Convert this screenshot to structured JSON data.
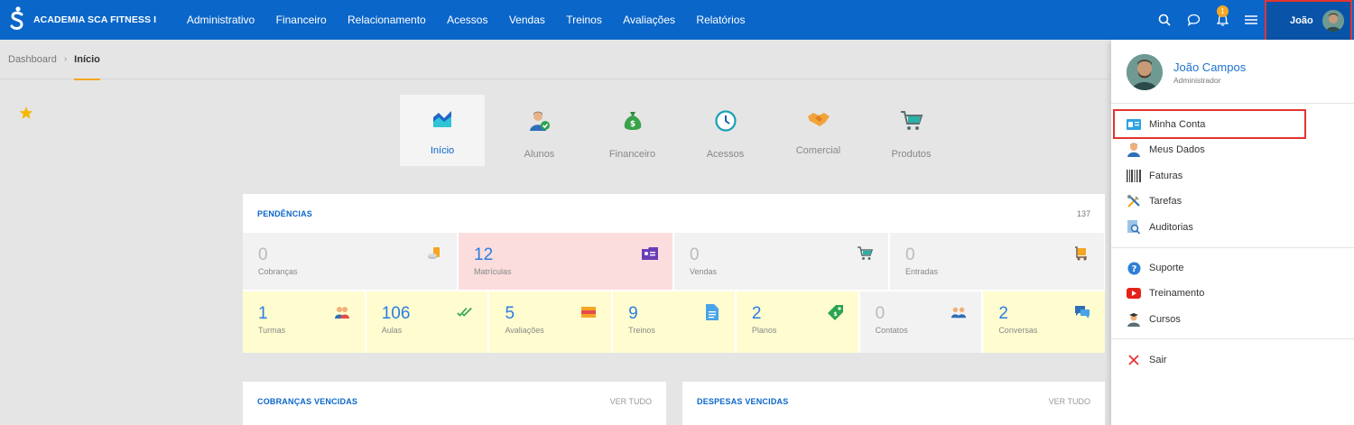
{
  "app": {
    "brand": "ACADEMIA SCA FITNESS I"
  },
  "nav": [
    "Administrativo",
    "Financeiro",
    "Relacionamento",
    "Acessos",
    "Vendas",
    "Treinos",
    "Avaliações",
    "Relatórios"
  ],
  "topbar": {
    "notification_count": "1",
    "user_name": "João"
  },
  "breadcrumb": {
    "root": "Dashboard",
    "current": "Início"
  },
  "modules": [
    {
      "label": "Início",
      "icon": "chart-area-icon",
      "active": true
    },
    {
      "label": "Alunos",
      "icon": "student-icon",
      "active": false
    },
    {
      "label": "Financeiro",
      "icon": "money-bag-icon",
      "active": false
    },
    {
      "label": "Acessos",
      "icon": "clock-icon",
      "active": false
    },
    {
      "label": "Comercial",
      "icon": "handshake-icon",
      "active": false
    },
    {
      "label": "Produtos",
      "icon": "cart-icon",
      "active": false
    }
  ],
  "pendencias": {
    "title": "PENDÊNCIAS",
    "count": "137",
    "row1": [
      {
        "value": "0",
        "label": "Cobranças",
        "icon": "coins-icon"
      },
      {
        "value": "12",
        "label": "Matrículas",
        "icon": "id-card-icon"
      },
      {
        "value": "0",
        "label": "Vendas",
        "icon": "cart-icon"
      },
      {
        "value": "0",
        "label": "Entradas",
        "icon": "cart-box-icon"
      }
    ],
    "row2": [
      {
        "value": "1",
        "label": "Turmas",
        "icon": "group-icon"
      },
      {
        "value": "106",
        "label": "Aulas",
        "icon": "double-check-icon"
      },
      {
        "value": "5",
        "label": "Avaliações",
        "icon": "ruler-icon"
      },
      {
        "value": "9",
        "label": "Treinos",
        "icon": "document-icon"
      },
      {
        "value": "2",
        "label": "Planos",
        "icon": "tag-icon"
      },
      {
        "value": "0",
        "label": "Contatos",
        "icon": "contacts-icon"
      },
      {
        "value": "2",
        "label": "Conversas",
        "icon": "chat-icon"
      }
    ]
  },
  "cobrancas": {
    "title": "COBRANÇAS VENCIDAS",
    "see_all": "VER TUDO"
  },
  "despesas": {
    "title": "DESPESAS VENCIDAS",
    "see_all": "VER TUDO"
  },
  "dropdown": {
    "name": "João Campos",
    "role": "Administrador",
    "items": [
      {
        "label": "Minha Conta",
        "icon": "account-card-icon"
      },
      {
        "label": "Meus Dados",
        "icon": "person-icon"
      },
      {
        "label": "Faturas",
        "icon": "barcode-icon"
      },
      {
        "label": "Tarefas",
        "icon": "tools-icon"
      },
      {
        "label": "Auditorias",
        "icon": "audit-icon"
      },
      {
        "label": "Suporte",
        "icon": "help-icon"
      },
      {
        "label": "Treinamento",
        "icon": "youtube-icon"
      },
      {
        "label": "Cursos",
        "icon": "graduate-icon"
      },
      {
        "label": "Sair",
        "icon": "close-icon"
      }
    ]
  }
}
